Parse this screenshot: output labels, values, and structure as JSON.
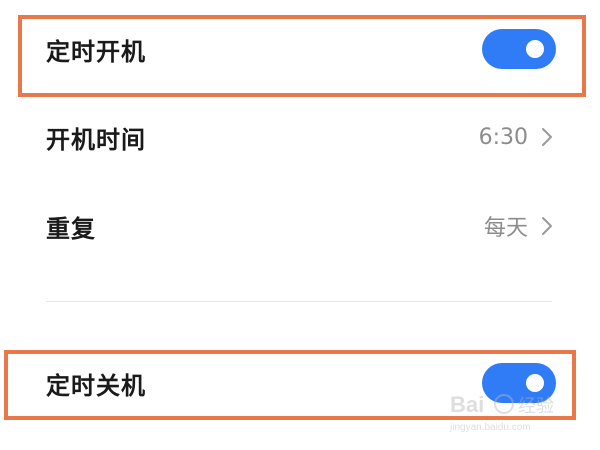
{
  "settings": {
    "scheduled_power_on": {
      "label": "定时开机",
      "enabled": true,
      "toggle_icon": "toggle-on-icon"
    },
    "power_on_time": {
      "label": "开机时间",
      "value": "6:30",
      "chevron_icon": "chevron-right-icon"
    },
    "repeat": {
      "label": "重复",
      "value": "每天",
      "chevron_icon": "chevron-right-icon"
    },
    "scheduled_power_off": {
      "label": "定时关机",
      "enabled": true,
      "toggle_icon": "toggle-on-icon"
    }
  },
  "colors": {
    "toggle_on": "#2f7cf6",
    "highlight": "#e8774a",
    "value_text": "#8c8c8c"
  },
  "watermark": {
    "text": "Bai 经验",
    "subtext": "jingyan.baidu.com"
  }
}
